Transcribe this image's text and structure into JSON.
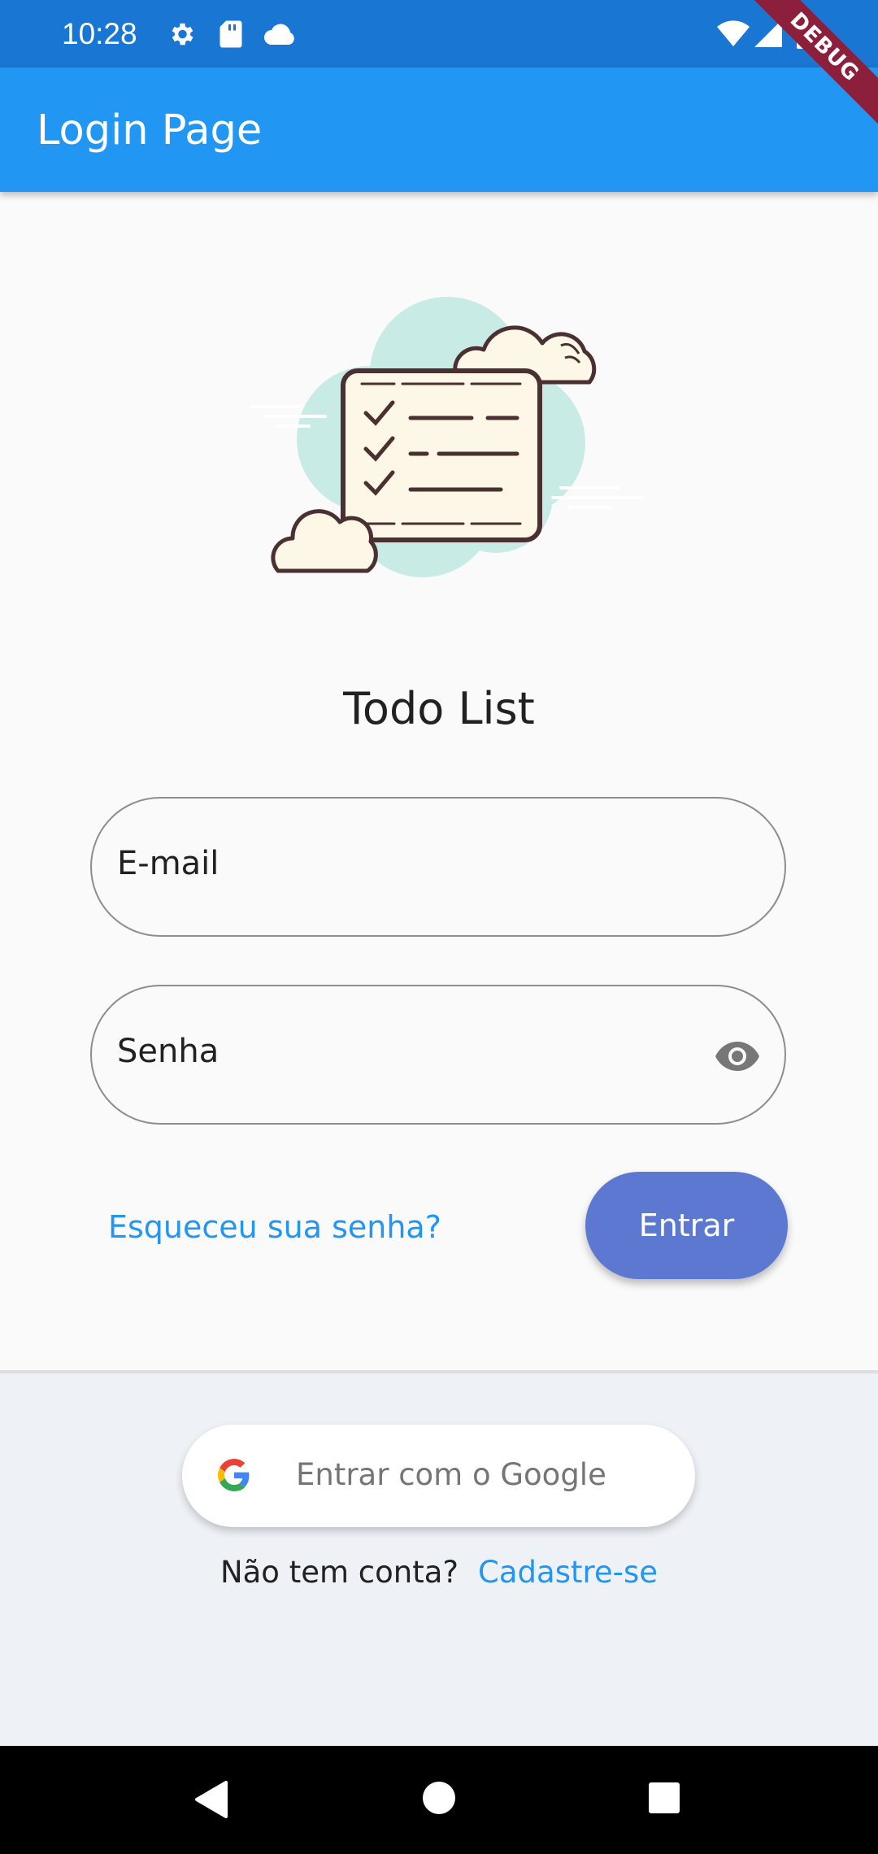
{
  "status_bar": {
    "time": "10:28",
    "left_icons": [
      "gear-icon",
      "sd-card-icon",
      "cloud-icon"
    ],
    "right_icons": [
      "wifi-icon",
      "signal-icon",
      "battery-icon"
    ]
  },
  "app_bar": {
    "title": "Login Page"
  },
  "debug_banner": {
    "label": "DEBUG"
  },
  "illustration": {
    "icon": "todo-checklist-illustration"
  },
  "main": {
    "title": "Todo List",
    "email_label": "E-mail",
    "password_label": "Senha",
    "forgot_password": "Esqueceu sua senha?",
    "enter_button": "Entrar"
  },
  "bottom": {
    "google_button": "Entrar com o Google",
    "no_account": "Não tem conta?",
    "signup_link": "Cadastre-se"
  },
  "nav_bar": {
    "icons": [
      "back-icon",
      "home-icon",
      "recents-icon"
    ]
  },
  "colors": {
    "status_bar": "#1976d2",
    "app_bar": "#2196f3",
    "accent": "#5c78d1",
    "link": "#2196f3",
    "cloud_bg": "#c8ece5"
  }
}
